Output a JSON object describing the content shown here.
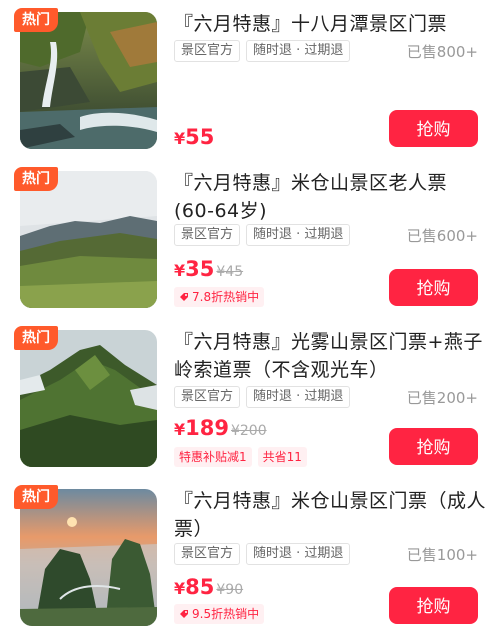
{
  "items": [
    {
      "badge": "热门",
      "title": "『六月特惠』十八月潭景区门票",
      "tags": [
        "景区官方",
        "随时退 · 过期退"
      ],
      "sold": "已售800+",
      "currency": "¥",
      "price": "55",
      "original_price": "",
      "promos": [],
      "buy_label": "抢购",
      "image": "waterfall-photo"
    },
    {
      "badge": "热门",
      "title": "『六月特惠』米仓山景区老人票(60-64岁)",
      "tags": [
        "景区官方",
        "随时退 · 过期退"
      ],
      "sold": "已售600+",
      "currency": "¥",
      "price": "35",
      "original_price": "¥45",
      "promos": [
        "7.8折热销中"
      ],
      "buy_label": "抢购",
      "image": "mountain-ridge-photo"
    },
    {
      "badge": "热门",
      "title": "『六月特惠』光雾山景区门票+燕子岭索道票（不含观光车）",
      "tags": [
        "景区官方",
        "随时退 · 过期退"
      ],
      "sold": "已售200+",
      "currency": "¥",
      "price": "189",
      "original_price": "¥200",
      "promos": [
        "特惠补贴减1",
        "共省11"
      ],
      "buy_label": "抢购",
      "image": "green-peak-photo"
    },
    {
      "badge": "热门",
      "title": "『六月特惠』米仓山景区门票（成人票）",
      "tags": [
        "景区官方",
        "随时退 · 过期退"
      ],
      "sold": "已售100+",
      "currency": "¥",
      "price": "85",
      "original_price": "¥90",
      "promos": [
        "9.5折热销中"
      ],
      "buy_label": "抢购",
      "image": "sunset-peak-photo"
    }
  ]
}
